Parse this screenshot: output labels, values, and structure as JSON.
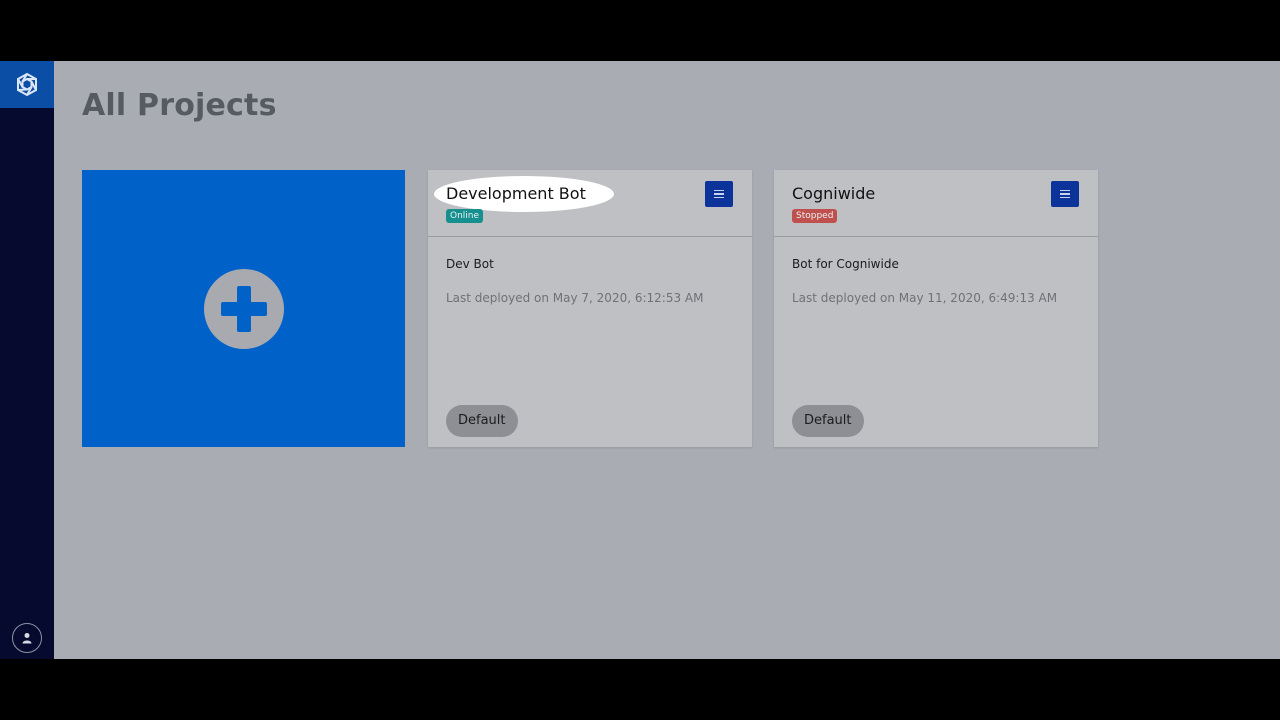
{
  "page": {
    "title": "All Projects"
  },
  "colors": {
    "background": "#a9acb3",
    "sidebar": "#050a2e",
    "accent": "#0062c8",
    "menu_button": "#0b3399",
    "online": "#178f8f",
    "stopped": "#c0504d"
  },
  "sidebar": {
    "logo_icon": "bot-framework-logo-icon",
    "user_icon": "user-icon"
  },
  "add_project": {
    "icon": "plus-icon"
  },
  "projects": [
    {
      "name": "Development Bot",
      "status": "Online",
      "status_color": "#178f8f",
      "description": "Dev Bot",
      "last_deployed": "Last deployed on May 7, 2020, 6:12:53 AM",
      "environment": "Default",
      "menu_icon": "hamburger-menu-icon"
    },
    {
      "name": "Cogniwide",
      "status": "Stopped",
      "status_color": "#c0504d",
      "description": "Bot for Cogniwide",
      "last_deployed": "Last deployed on May 11, 2020, 6:49:13 AM",
      "environment": "Default",
      "menu_icon": "hamburger-menu-icon"
    }
  ]
}
